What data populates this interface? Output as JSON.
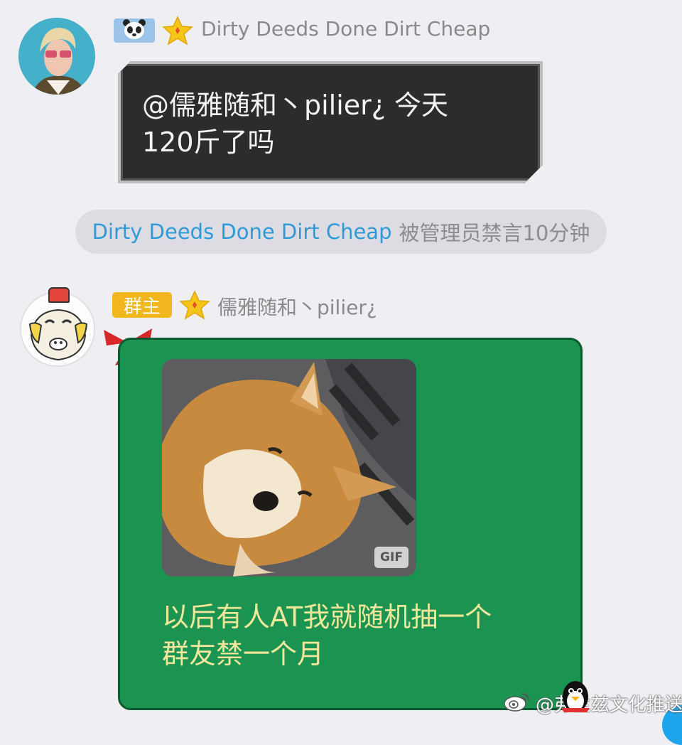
{
  "messages": [
    {
      "sender": "Dirty Deeds Done Dirt Cheap",
      "badge_icon": "panda-icon",
      "level_icon": "star-icon",
      "text_line1": "@儒雅随和丶pilier¿ 今天",
      "text_line2": "120斤了吗"
    },
    {
      "sender": "儒雅随和丶pilier¿",
      "role_badge": "群主",
      "level_icon": "star-icon",
      "gif_label": "GIF",
      "text_line1": "以后有人AT我就随机抽一个",
      "text_line2": "群友禁一个月"
    }
  ],
  "system_notice": {
    "user": "Dirty Deeds Done Dirt Cheap",
    "action": "被管理员禁言10分钟"
  },
  "watermark": "@弗兰兹文化推送",
  "colors": {
    "background": "#eeeef3",
    "dark_bubble": "#2c2c2c",
    "green_bubble": "#1b9452",
    "green_text": "#f2e69a",
    "link_blue": "#2e9ad8",
    "owner_badge": "#f2b71f",
    "star": "#f5c518"
  }
}
